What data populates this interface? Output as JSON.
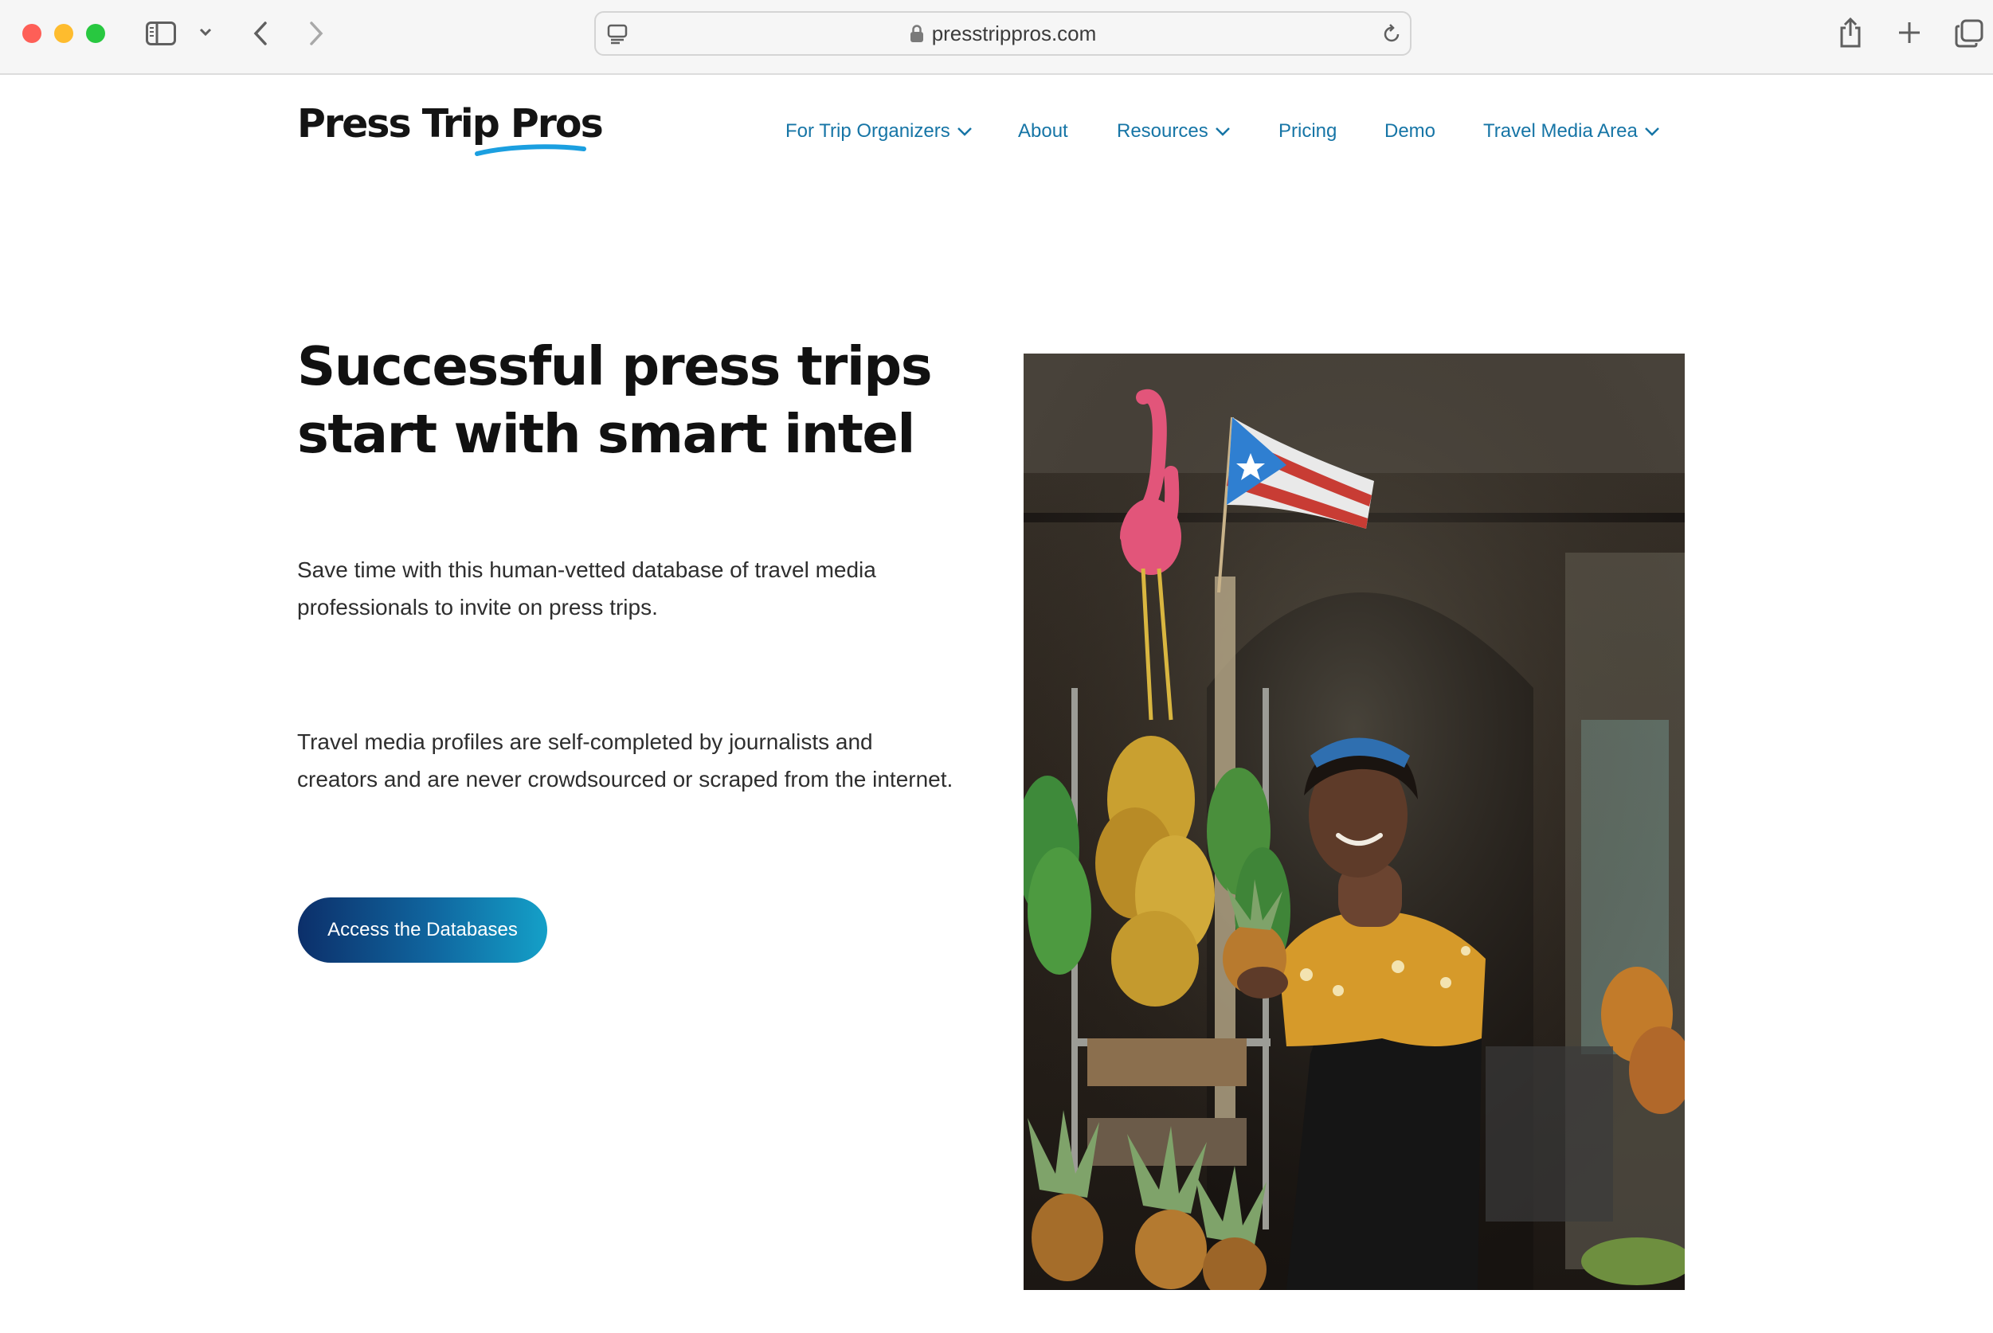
{
  "browser": {
    "url": "presstrippros.com",
    "icons": [
      "sidebar-icon",
      "chevron-down-icon",
      "back-icon",
      "forward-icon",
      "reader-icon",
      "lock-icon",
      "reload-icon",
      "share-icon",
      "new-tab-icon",
      "tabs-overview-icon"
    ]
  },
  "site": {
    "logo": "Press Trip Pros",
    "accent_color": "#1675a6",
    "nav": [
      {
        "label": "For Trip Organizers",
        "dropdown": true
      },
      {
        "label": "About",
        "dropdown": false
      },
      {
        "label": "Resources",
        "dropdown": true
      },
      {
        "label": "Pricing",
        "dropdown": false
      },
      {
        "label": "Demo",
        "dropdown": false
      },
      {
        "label": "Travel Media Area",
        "dropdown": true
      }
    ]
  },
  "hero": {
    "title_line1": "Successful press trips",
    "title_line2": "start with smart intel",
    "para1_line1": "Save time with this human-vetted database of travel media",
    "para1_line2": "professionals to invite on press trips.",
    "para2_line1": "Travel media profiles are self-completed by journalists and",
    "para2_line2": "creators and are never crowdsourced or scraped from the internet.",
    "cta_label": "Access the Databases"
  }
}
